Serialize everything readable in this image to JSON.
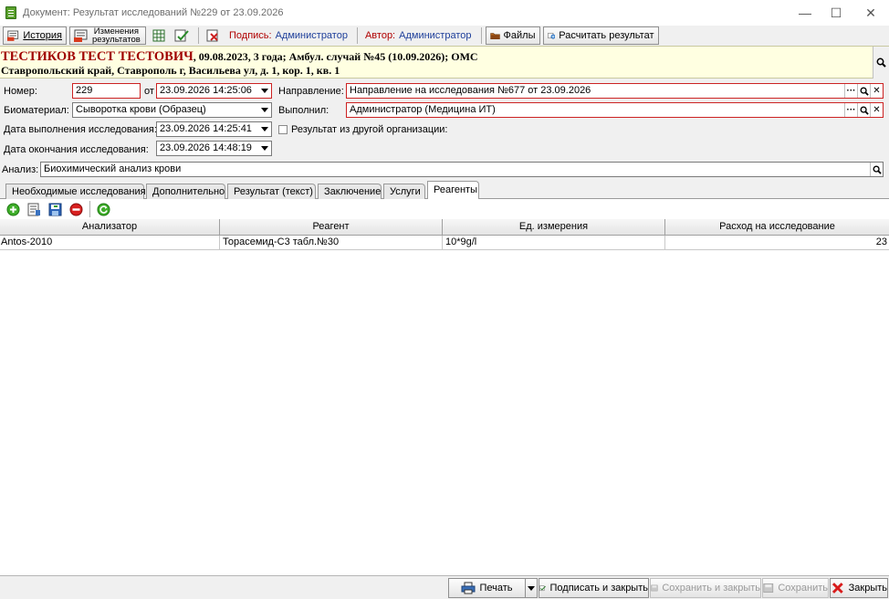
{
  "window": {
    "title": "Документ: Результат исследований №229 от 23.09.2026",
    "minimize": "—",
    "maximize": "☐",
    "close": "✕"
  },
  "toolbar": {
    "history_label": "История",
    "changes_label_1": "Изменения",
    "changes_label_2": "результатов",
    "signature_label": "Подпись:",
    "signature_value": "Администратор",
    "author_label": "Автор:",
    "author_value": "Администратор",
    "files_label": "Файлы",
    "calculate_label": "Расчитать результат"
  },
  "patient": {
    "name": "ТЕСТИКОВ ТЕСТ ТЕСТОВИЧ",
    "details": ", 09.08.2023, 3 года; Амбул. случай №45 (10.09.2026); ОМС",
    "address": "Ставропольский край, Ставрополь г, Васильева ул, д. 1, кор. 1, кв. 1"
  },
  "form": {
    "number_label": "Номер:",
    "number_value": "229",
    "from_label": "от",
    "from_value": "23.09.2026 14:25:06",
    "direction_label": "Направление:",
    "direction_value": "Направление на исследования №677 от 23.09.2026",
    "biomaterial_label": "Биоматериал:",
    "biomaterial_value": "Сыворотка крови (Образец)",
    "performed_label": "Выполнил:",
    "performed_value": "Администратор (Медицина ИТ)",
    "exec_date_label": "Дата выполнения исследования:",
    "exec_date_value": "23.09.2026 14:25:41",
    "other_org_label": "Результат из другой организации:",
    "end_date_label": "Дата окончания исследования:",
    "end_date_value": "23.09.2026 14:48:19",
    "analysis_label": "Анализ:",
    "analysis_value": "Биохимический анализ крови",
    "ellipsis": "···",
    "clear": "✕"
  },
  "tabs": [
    {
      "label": "Необходимые исследования"
    },
    {
      "label": "Дополнительно"
    },
    {
      "label": "Результат (текст)"
    },
    {
      "label": "Заключение"
    },
    {
      "label": "Услуги"
    },
    {
      "label": "Реагенты"
    }
  ],
  "grid": {
    "columns": [
      "Анализатор",
      "Реагент",
      "Ед. измерения",
      "Расход на исследование"
    ],
    "rows": [
      {
        "analyzer": "Antos-2010",
        "reagent": "Торасемид-С3 табл.№30",
        "unit": "10*9g/l",
        "consumption": "23"
      }
    ]
  },
  "bottom": {
    "print_label": "Печать",
    "sign_close_label": "Подписать и закрыть",
    "save_close_label": "Сохранить и закрыть",
    "save_label": "Сохранить",
    "close_label": "Закрыть"
  },
  "colors": {
    "patient_bg": "#ffffe1",
    "patient_name": "#a00000",
    "required_border": "#cc2222",
    "signature_blue": "#1e3f9a",
    "signature_red": "#b00000"
  }
}
